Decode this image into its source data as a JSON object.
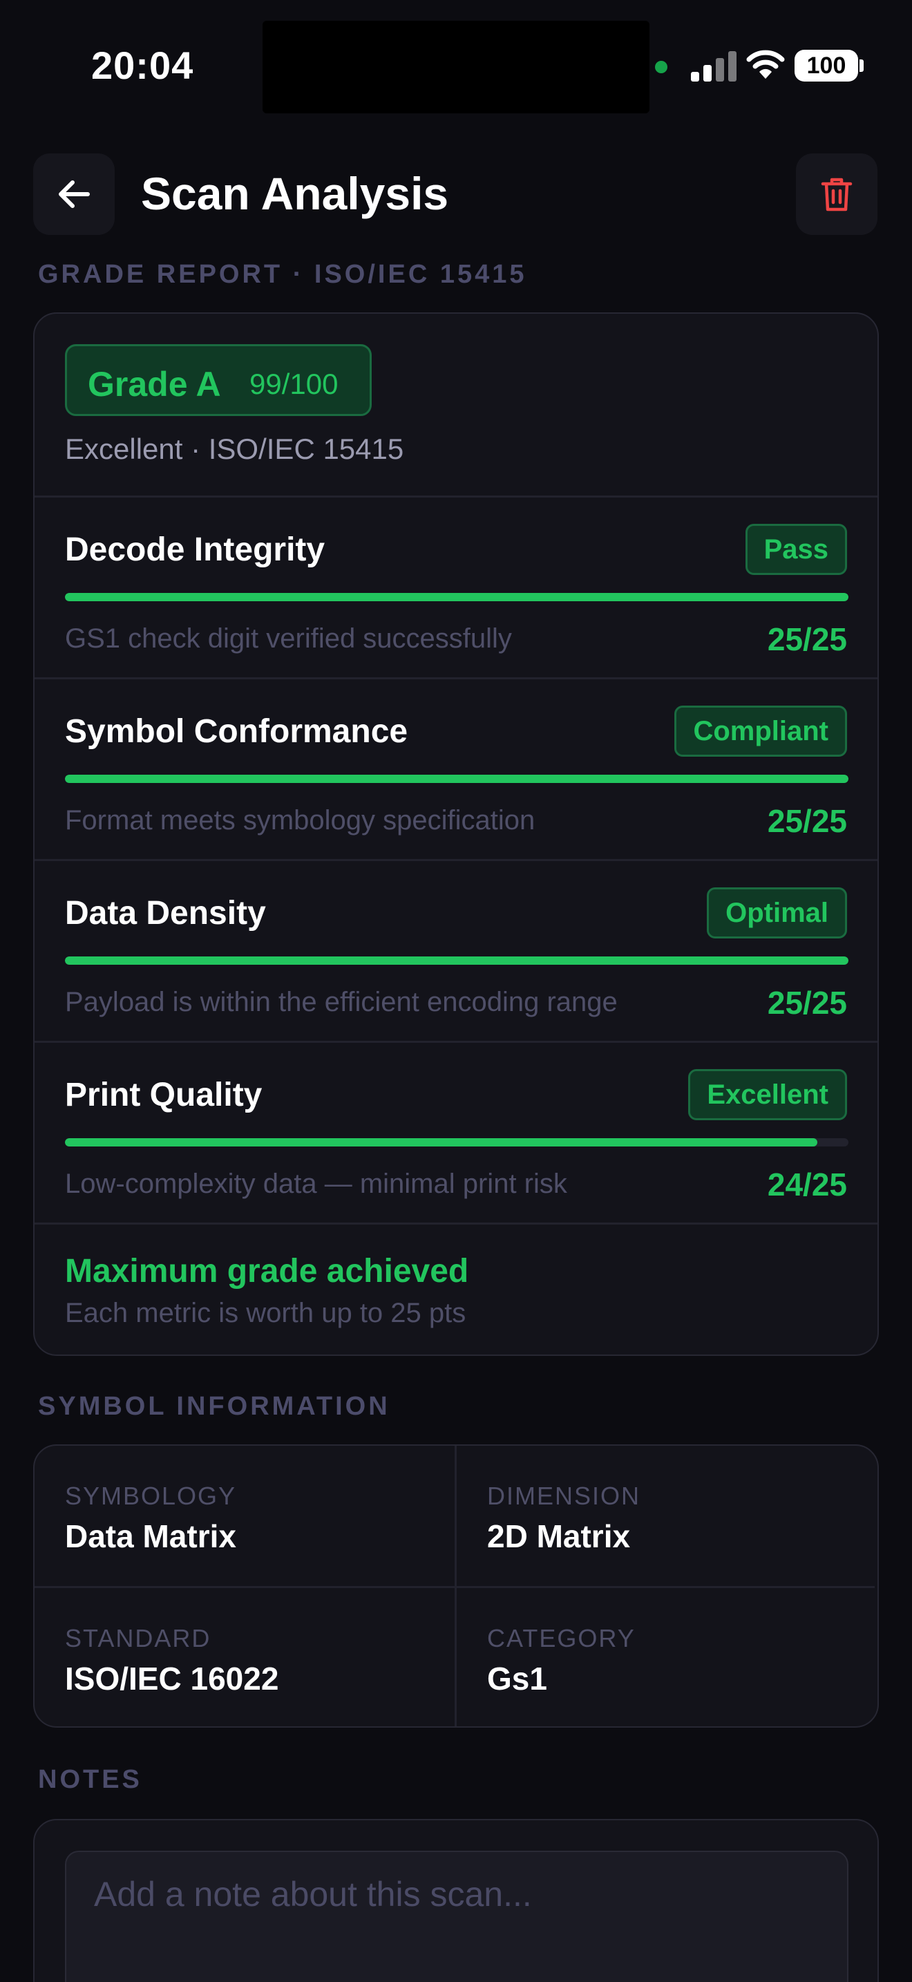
{
  "status_bar": {
    "time": "20:04",
    "battery": "100"
  },
  "header": {
    "title": "Scan Analysis",
    "back_icon": "arrow-left-icon",
    "delete_icon": "trash-icon"
  },
  "grade_report": {
    "section_label": "GRADE REPORT · ISO/IEC 15415",
    "grade_label": "Grade A",
    "score": "99/100",
    "subtitle": "Excellent · ISO/IEC 15415",
    "metrics": [
      {
        "name": "Decode Integrity",
        "badge": "Pass",
        "description": "GS1 check digit verified successfully",
        "score": "25/25",
        "fill_fraction": 1.0
      },
      {
        "name": "Symbol Conformance",
        "badge": "Compliant",
        "description": "Format meets symbology specification",
        "score": "25/25",
        "fill_fraction": 1.0
      },
      {
        "name": "Data Density",
        "badge": "Optimal",
        "description": "Payload is within the efficient encoding range",
        "score": "25/25",
        "fill_fraction": 1.0
      },
      {
        "name": "Print Quality",
        "badge": "Excellent",
        "description": "Low-complexity data — minimal print risk",
        "score": "24/25",
        "fill_fraction": 0.96
      }
    ],
    "summary_title": "Maximum grade achieved",
    "summary_subtitle": "Each metric is worth up to 25 pts"
  },
  "symbol_info": {
    "section_label": "SYMBOL INFORMATION",
    "cells": [
      {
        "key": "SYMBOLOGY",
        "value": "Data Matrix"
      },
      {
        "key": "DIMENSION",
        "value": "2D Matrix"
      },
      {
        "key": "STANDARD",
        "value": "ISO/IEC 16022"
      },
      {
        "key": "CATEGORY",
        "value": "Gs1"
      }
    ]
  },
  "notes": {
    "section_label": "NOTES",
    "placeholder": "Add a note about this scan...",
    "value": ""
  },
  "colors": {
    "background": "#0c0c11",
    "card": "#13131a",
    "accent_green": "#22c55e",
    "danger_red": "#ef4444",
    "muted_text": "#4f4f68"
  }
}
